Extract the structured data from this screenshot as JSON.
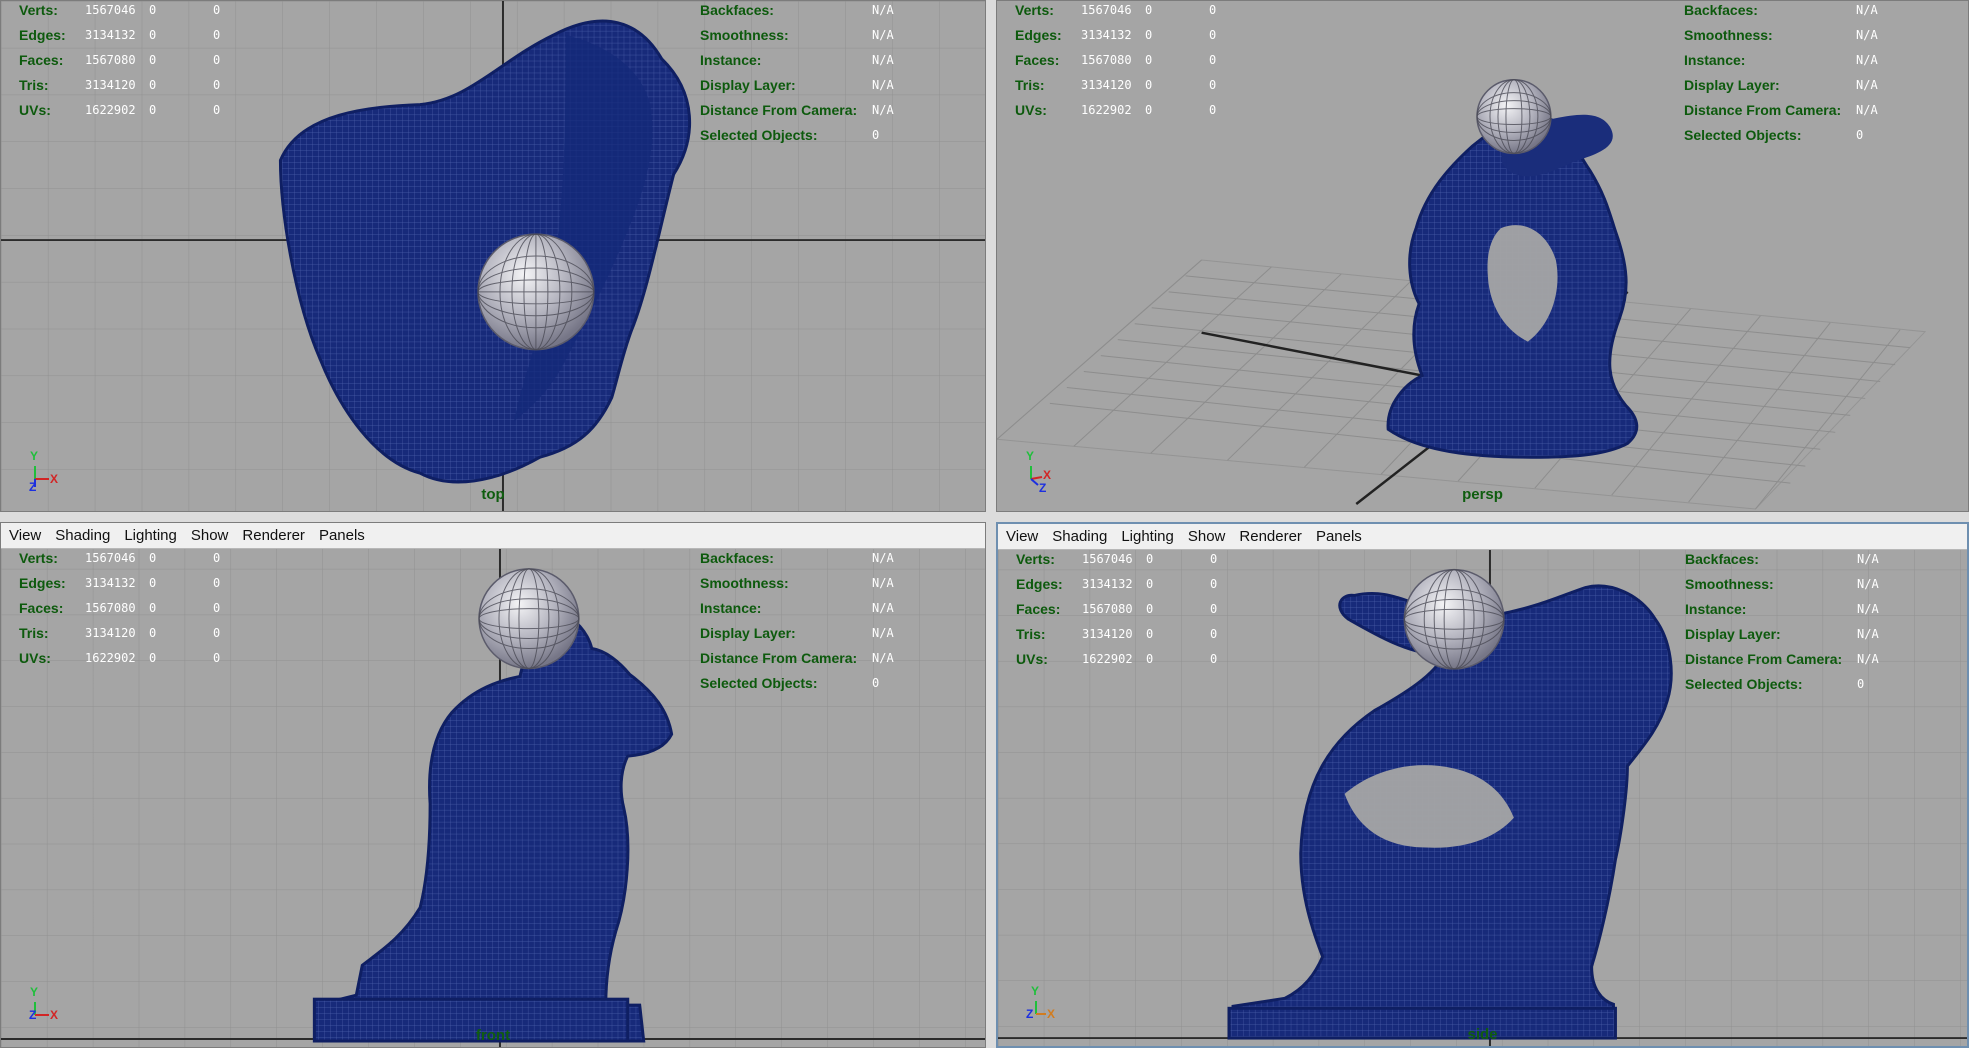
{
  "menus": [
    "View",
    "Shading",
    "Lighting",
    "Show",
    "Renderer",
    "Panels"
  ],
  "hud": {
    "left": [
      {
        "label": "Verts:",
        "value": "1567046",
        "v2": "0",
        "v3": "0"
      },
      {
        "label": "Edges:",
        "value": "3134132",
        "v2": "0",
        "v3": "0"
      },
      {
        "label": "Faces:",
        "value": "1567080",
        "v2": "0",
        "v3": "0"
      },
      {
        "label": "Tris:",
        "value": "3134120",
        "v2": "0",
        "v3": "0"
      },
      {
        "label": "UVs:",
        "value": "1622902",
        "v2": "0",
        "v3": "0"
      }
    ],
    "right": [
      {
        "label": "Backfaces:",
        "value": "N/A"
      },
      {
        "label": "Smoothness:",
        "value": "N/A"
      },
      {
        "label": "Instance:",
        "value": "N/A"
      },
      {
        "label": "Display Layer:",
        "value": "N/A"
      },
      {
        "label": "Distance From Camera:",
        "value": "N/A"
      },
      {
        "label": "Selected Objects:",
        "value": "0"
      }
    ]
  },
  "viewports": [
    {
      "name": "top",
      "label": "top"
    },
    {
      "name": "persp",
      "label": "persp"
    },
    {
      "name": "front",
      "label": "front"
    },
    {
      "name": "side",
      "label": "side"
    }
  ],
  "axis": {
    "x": "X",
    "y": "Y",
    "z": "Z"
  },
  "colors": {
    "mesh": "#172a7a",
    "mesh_dark": "#0f1f63",
    "viewport_bg": "#a5a5a5",
    "grid": "#8f8f8f",
    "axis_x": "#d22525",
    "axis_y": "#1fbf3b",
    "axis_z": "#1c2fe0",
    "hud_label": "#0d5a0d",
    "hud_value": "#ffffff"
  }
}
